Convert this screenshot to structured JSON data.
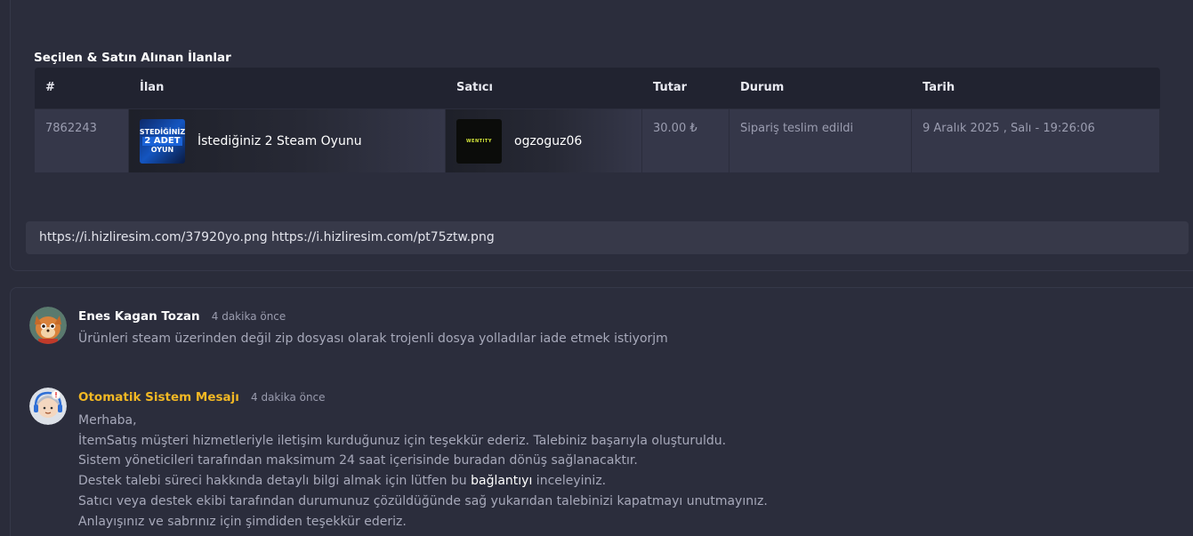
{
  "section": {
    "title": "Seçilen & Satın Alınan İlanlar"
  },
  "table": {
    "headers": [
      "#",
      "İlan",
      "Satıcı",
      "Tutar",
      "Durum",
      "Tarih"
    ],
    "row": {
      "id": "7862243",
      "item_thumb": {
        "line1": "STEDİĞİNİZ",
        "line2": "2 ADET",
        "line3": "OYUN"
      },
      "item_title": "İstediğiniz 2 Steam Oyunu",
      "seller_thumb": "WENTITY",
      "seller": "ogzoguz06",
      "amount": "30.00 ₺",
      "status": "Sipariş teslim edildi",
      "date": "9 Aralık 2025 , Salı - 19:26:06"
    }
  },
  "links_text": "https://i.hizliresim.com/37920yo.png https://i.hizliresim.com/pt75ztw.png",
  "messages": [
    {
      "author": "Enes Kagan Tozan",
      "time": "4 dakika önce",
      "text": "Ürünleri steam üzerinden değil zip dosyası olarak trojenli dosya yolladılar iade etmek istiyorjm",
      "avatar_icon": "fox-avatar-icon"
    },
    {
      "author": "Otomatik Sistem Mesajı",
      "time": "4 dakika önce",
      "avatar_icon": "support-agent-icon",
      "lines": [
        "Merhaba,",
        "İtemSatış müşteri hizmetleriyle iletişim kurduğunuz için teşekkür ederiz. Talebiniz başarıyla oluşturuldu.",
        "Sistem yöneticileri tarafından maksimum 24 saat içerisinde buradan dönüş sağlanacaktır."
      ],
      "line4_before": "Destek talebi süreci hakkında detaylı bilgi almak için lütfen bu ",
      "line4_link": "bağlantıyı",
      "line4_after": " inceleyiniz.",
      "lines_end": [
        "Satıcı veya destek ekibi tarafından durumunuz çözüldüğünde sağ yukarıdan talebinizi kapatmayı unutmayınız.",
        "Anlayışınız ve sabrınız için şimdiden teşekkür ederiz."
      ]
    }
  ],
  "colors": {
    "background": "#2a2c3a",
    "system_author": "#f2b824"
  }
}
